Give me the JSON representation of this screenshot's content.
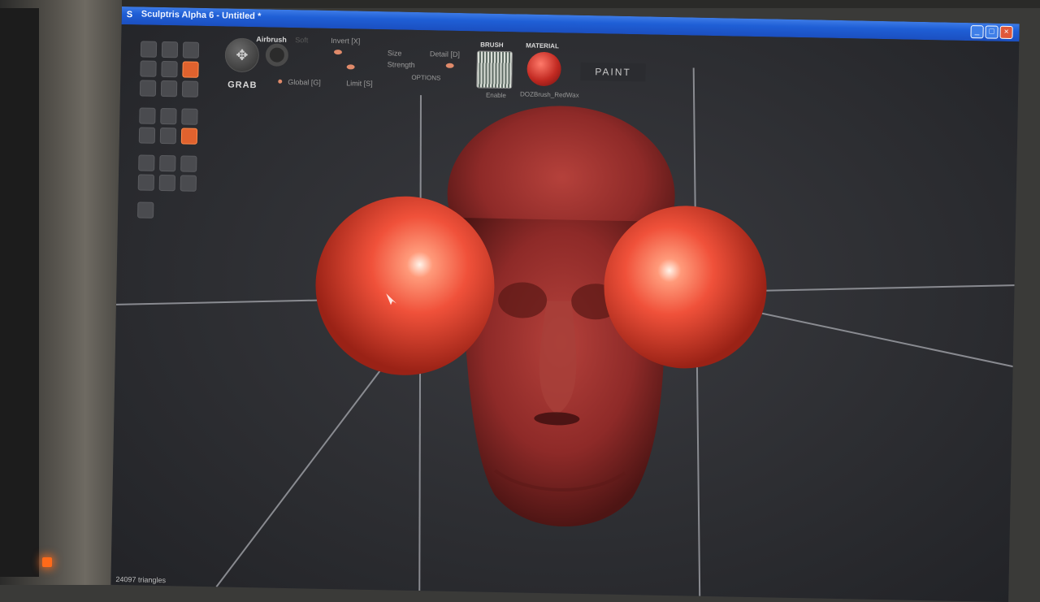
{
  "window": {
    "title": "Sculptris Alpha 6 - Untitled *"
  },
  "toolbar": {
    "tool_name": "GRAB",
    "airbrush_label": "Airbrush",
    "soft_label": "Soft",
    "invert_label": "Invert [X]",
    "size_label": "Size",
    "strength_label": "Strength",
    "detail_label": "Detail [D]",
    "global_label": "Global [G]",
    "limit_label": "Limit [S]",
    "options_label": "OPTIONS",
    "brush_header": "BRUSH",
    "brush_enable": "Enable",
    "material_header": "MATERIAL",
    "material_name": "DOZBrush_RedWax",
    "paint_button": "PAINT"
  },
  "status": {
    "triangles": "24097 triangles"
  },
  "colors": {
    "accent": "#e0622e",
    "material": "#d8342a",
    "titlebar": "#1f5fd6"
  }
}
